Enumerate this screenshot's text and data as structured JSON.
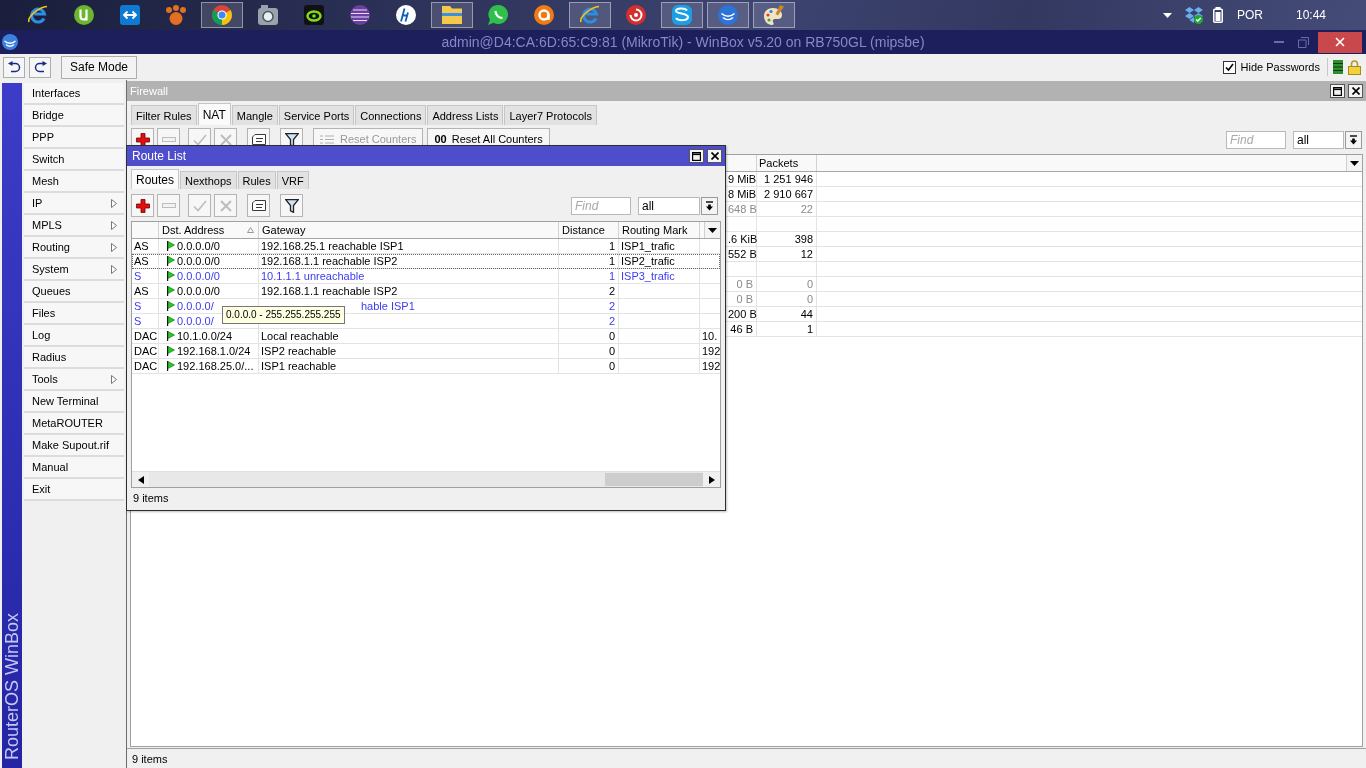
{
  "taskbar": {
    "apps": [
      {
        "kind": "ebrowser",
        "open": false
      },
      {
        "kind": "mu",
        "open": false
      },
      {
        "kind": "tile",
        "open": false
      },
      {
        "kind": "paw",
        "open": false
      },
      {
        "kind": "wheel",
        "open": true
      },
      {
        "kind": "camera",
        "open": false
      },
      {
        "kind": "ring",
        "open": false
      },
      {
        "kind": "sphere",
        "open": false
      },
      {
        "kind": "disc",
        "open": false
      },
      {
        "kind": "folder",
        "open": true
      },
      {
        "kind": "bubble",
        "open": false
      },
      {
        "kind": "swirl",
        "open": false
      },
      {
        "kind": "ebrowser",
        "open": true
      },
      {
        "kind": "spiral",
        "open": false
      },
      {
        "kind": "wave",
        "open": true
      },
      {
        "kind": "arcs",
        "open": true
      },
      {
        "kind": "palette",
        "open": true
      }
    ],
    "language": "POR",
    "clock": "10:44"
  },
  "window": {
    "title": "admin@D4:CA:6D:65:C9:81 (MikroTik) - WinBox v5.20 on RB750GL (mipsbe)"
  },
  "toolbar": {
    "safe_mode": "Safe Mode",
    "hide_passwords": {
      "label": "Hide Passwords",
      "checked": true
    }
  },
  "sidebar": {
    "brand": "RouterOS WinBox",
    "items": [
      {
        "label": "Interfaces",
        "submenu": false
      },
      {
        "label": "Bridge",
        "submenu": false
      },
      {
        "label": "PPP",
        "submenu": false
      },
      {
        "label": "Switch",
        "submenu": false
      },
      {
        "label": "Mesh",
        "submenu": false
      },
      {
        "label": "IP",
        "submenu": true
      },
      {
        "label": "MPLS",
        "submenu": true
      },
      {
        "label": "Routing",
        "submenu": true
      },
      {
        "label": "System",
        "submenu": true
      },
      {
        "label": "Queues",
        "submenu": false
      },
      {
        "label": "Files",
        "submenu": false
      },
      {
        "label": "Log",
        "submenu": false
      },
      {
        "label": "Radius",
        "submenu": false
      },
      {
        "label": "Tools",
        "submenu": true
      },
      {
        "label": "New Terminal",
        "submenu": false
      },
      {
        "label": "MetaROUTER",
        "submenu": false
      },
      {
        "label": "Make Supout.rif",
        "submenu": false
      },
      {
        "label": "Manual",
        "submenu": false
      },
      {
        "label": "Exit",
        "submenu": false
      }
    ]
  },
  "firewall": {
    "title": "Firewall",
    "tabs": [
      {
        "label": "Filter Rules",
        "selected": false
      },
      {
        "label": "NAT",
        "selected": true
      },
      {
        "label": "Mangle",
        "selected": false
      },
      {
        "label": "Service Ports",
        "selected": false
      },
      {
        "label": "Connections",
        "selected": false
      },
      {
        "label": "Address Lists",
        "selected": false
      },
      {
        "label": "Layer7 Protocols",
        "selected": false
      }
    ],
    "toolbar": {
      "buttons": [
        {
          "kind": "add",
          "disabled": false
        },
        {
          "kind": "remove",
          "disabled": true
        },
        {
          "kind": "enable",
          "disabled": true
        },
        {
          "kind": "disable",
          "disabled": true
        },
        {
          "kind": "comment",
          "disabled": false
        },
        {
          "kind": "filter",
          "disabled": false
        }
      ],
      "counters": [
        {
          "kind": "reset",
          "label": "Reset Counters",
          "disabled": true
        },
        {
          "kind": "resetall",
          "glyph": "00",
          "label": "Reset All Counters",
          "disabled": false
        }
      ],
      "find_placeholder": "Find",
      "filter": "all"
    },
    "table": {
      "columns": [
        "Packets"
      ],
      "rows": [
        {
          "kind": "data",
          "column_1": "9 MiB",
          "packets": "1 251 946",
          "disabled": false
        },
        {
          "kind": "data",
          "column_1": "8 MiB",
          "packets": "2 910 667",
          "disabled": false
        },
        {
          "kind": "data",
          "column_1": "648 B",
          "packets": "22",
          "disabled": true
        },
        {
          "kind": "blank"
        },
        {
          "kind": "data",
          "column_1": ".6 KiB",
          "packets": "398",
          "disabled": false
        },
        {
          "kind": "data",
          "column_1": "552 B",
          "packets": "12",
          "disabled": false
        },
        {
          "kind": "blank"
        },
        {
          "kind": "data",
          "column_1": "0 B",
          "packets": "0",
          "disabled": true
        },
        {
          "kind": "data",
          "column_1": "0 B",
          "packets": "0",
          "disabled": true
        },
        {
          "kind": "data",
          "column_1": "200 B",
          "packets": "44",
          "disabled": false
        },
        {
          "kind": "data",
          "column_1": "46 B",
          "packets": "1",
          "disabled": false
        }
      ]
    },
    "status": "9 items"
  },
  "route_list": {
    "title": "Route List",
    "tabs": [
      {
        "label": "Routes",
        "selected": true
      },
      {
        "label": "Nexthops",
        "selected": false
      },
      {
        "label": "Rules",
        "selected": false
      },
      {
        "label": "VRF",
        "selected": false
      }
    ],
    "toolbar": {
      "buttons": [
        {
          "kind": "add",
          "disabled": false
        },
        {
          "kind": "remove",
          "disabled": true
        },
        {
          "kind": "enable",
          "disabled": true
        },
        {
          "kind": "disable",
          "disabled": true
        },
        {
          "kind": "comment",
          "disabled": false
        },
        {
          "kind": "filter",
          "disabled": false
        }
      ],
      "find_placeholder": "Find",
      "filter": "all"
    },
    "columns": [
      {
        "label": "Dst. Address",
        "sorted": true
      },
      {
        "label": "Gateway",
        "sorted": false
      },
      {
        "label": "Distance",
        "sorted": false
      },
      {
        "label": "Routing Mark",
        "sorted": false
      }
    ],
    "rows": [
      {
        "flags": "AS",
        "dst": "0.0.0.0/0",
        "gateway": "192.168.25.1 reachable ISP1",
        "distance": "1",
        "routing_mark": "ISP1_trafic",
        "active": true,
        "focused": false,
        "hovered": false
      },
      {
        "flags": "AS",
        "dst": "0.0.0.0/0",
        "gateway": "192.168.1.1 reachable ISP2",
        "distance": "1",
        "routing_mark": "ISP2_trafic",
        "active": true,
        "focused": true,
        "hovered": false
      },
      {
        "flags": "S",
        "dst": "0.0.0.0/0",
        "gateway": "10.1.1.1 unreachable",
        "distance": "1",
        "routing_mark": "ISP3_trafic",
        "active": false,
        "focused": false,
        "hovered": false
      },
      {
        "flags": "AS",
        "dst": "0.0.0.0/0",
        "gateway": "192.168.1.1 reachable ISP2",
        "distance": "2",
        "active": true,
        "focused": false,
        "hovered": false
      },
      {
        "flags": "S",
        "dst": "0.0.0.0/",
        "gateway": "hable ISP1",
        "distance": "2",
        "active": false,
        "focused": false,
        "hovered": true
      },
      {
        "flags": "S",
        "dst": "0.0.0.0/",
        "distance": "2",
        "active": false,
        "focused": false,
        "hovered": false
      },
      {
        "flags": "DAC",
        "dst": "10.1.0.0/24",
        "gateway": "Local reachable",
        "distance": "0",
        "column_5": "10.",
        "active": true,
        "focused": false,
        "hovered": false
      },
      {
        "flags": "DAC",
        "dst": "192.168.1.0/24",
        "gateway": "ISP2 reachable",
        "distance": "0",
        "column_5": "192",
        "active": true,
        "focused": false,
        "hovered": false
      },
      {
        "flags": "DAC",
        "dst": "192.168.25.0/...",
        "gateway": "ISP1 reachable",
        "distance": "0",
        "column_5": "192",
        "active": true,
        "focused": false,
        "hovered": false
      }
    ],
    "tooltip": "0.0.0.0 - 255.255.255.255",
    "status": "9 items"
  }
}
